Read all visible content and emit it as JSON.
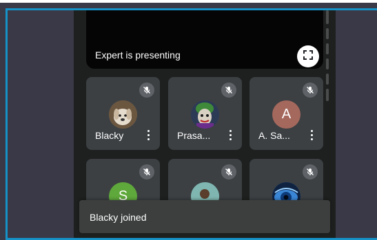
{
  "presentation": {
    "label": "Expert is presenting"
  },
  "participants": [
    {
      "name": "Blacky",
      "initial": "",
      "avatar_kind": "dog-photo",
      "avatar_color": "#8a6a4a",
      "muted": true
    },
    {
      "name": "Prasa...",
      "initial": "",
      "avatar_kind": "joker-photo",
      "avatar_color": "#5a2f6e",
      "muted": true
    },
    {
      "name": "A. Sa...",
      "initial": "A",
      "avatar_kind": "letter",
      "avatar_color": "#a5685d",
      "muted": true
    },
    {
      "name": "",
      "initial": "S",
      "avatar_kind": "letter",
      "avatar_color": "#5fa83b",
      "muted": true
    },
    {
      "name": "",
      "initial": "",
      "avatar_kind": "person-photo",
      "avatar_color": "#6aa7a0",
      "muted": true
    },
    {
      "name": "",
      "initial": "",
      "avatar_kind": "eye-photo",
      "avatar_color": "#2566b8",
      "muted": true
    }
  ],
  "toast": {
    "message": "Blacky joined"
  },
  "colors": {
    "accent_border": "#1592c8",
    "tile_bg": "#3c4043",
    "call_bg": "#1e201f"
  },
  "icons": {
    "mute": "mic-off-icon",
    "fullscreen": "fullscreen-icon",
    "more": "more-vert-icon"
  }
}
